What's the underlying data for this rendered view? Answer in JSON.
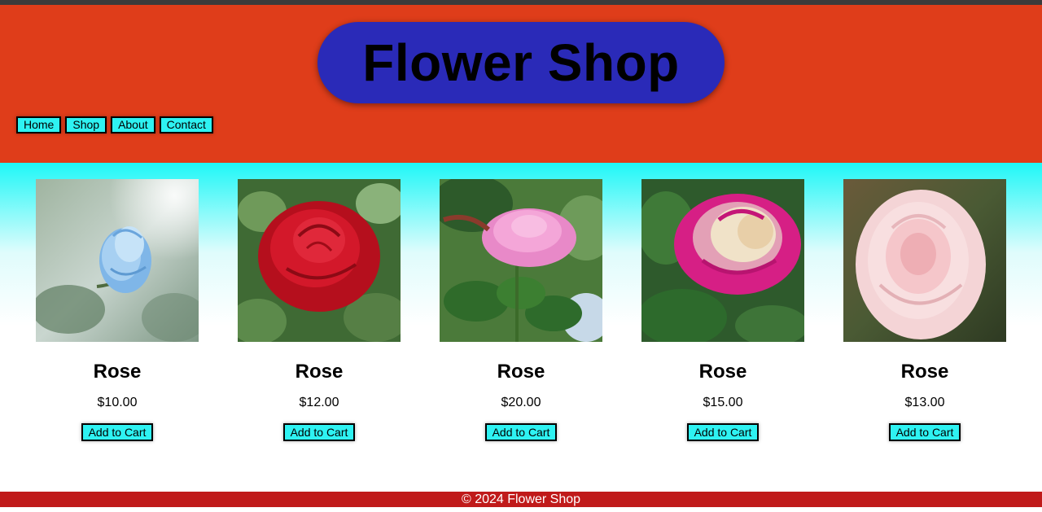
{
  "header": {
    "title": "Flower Shop",
    "nav": [
      "Home",
      "Shop",
      "About",
      "Contact"
    ]
  },
  "products": [
    {
      "name": "Rose",
      "price": "$10.00",
      "button": "Add to Cart",
      "image": "blue-rose"
    },
    {
      "name": "Rose",
      "price": "$12.00",
      "button": "Add to Cart",
      "image": "red-rose"
    },
    {
      "name": "Rose",
      "price": "$20.00",
      "button": "Add to Cart",
      "image": "pink-rose"
    },
    {
      "name": "Rose",
      "price": "$15.00",
      "button": "Add to Cart",
      "image": "magenta-cream-rose"
    },
    {
      "name": "Rose",
      "price": "$13.00",
      "button": "Add to Cart",
      "image": "pale-pink-rose"
    }
  ],
  "footer": {
    "text": "© 2024 Flower Shop"
  },
  "colors": {
    "header_bg": "#df3d1a",
    "title_pill": "#2a2ab8",
    "button_bg": "#2ef2f2",
    "footer_bg": "#c01a1a"
  }
}
